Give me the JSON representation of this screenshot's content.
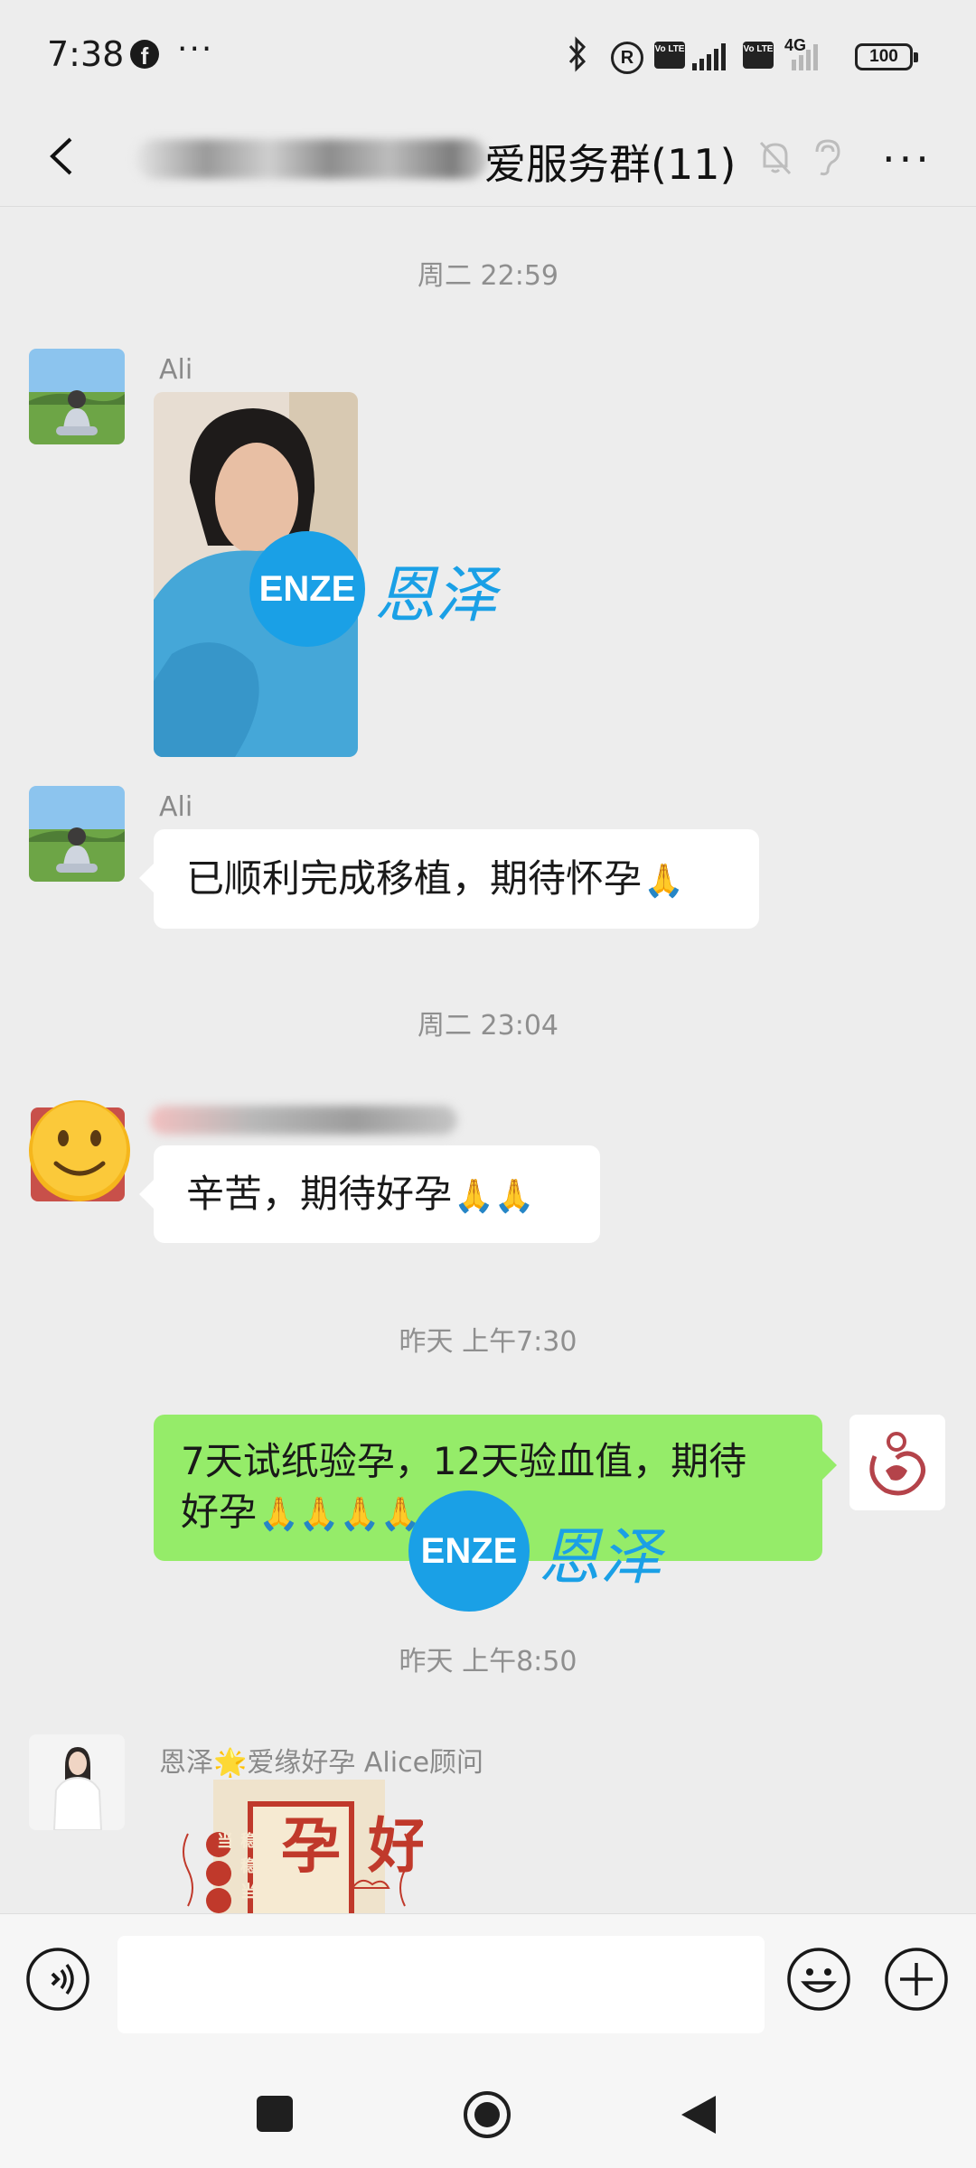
{
  "status": {
    "time": "7:38",
    "more": "···",
    "reg_mark": "R",
    "volte": "Vo LTE",
    "net_type": "4G",
    "battery": "100"
  },
  "header": {
    "title": "爱服务群(11)"
  },
  "messages": [
    {
      "type": "time",
      "text": "周二 22:59"
    },
    {
      "type": "image",
      "sender": "Ali",
      "watermark_logo": "ENZE",
      "watermark_text": "恩泽"
    },
    {
      "type": "text",
      "sender": "Ali",
      "text": "已顺利完成移植，期待怀孕",
      "emoji": "🙏"
    },
    {
      "type": "time",
      "text": "周二 23:04"
    },
    {
      "type": "text",
      "sender": "",
      "text": "辛苦，期待好孕",
      "emoji": "🙏🙏"
    },
    {
      "type": "time",
      "text": "昨天 上午7:30"
    },
    {
      "type": "outgoing",
      "line1": "7天试纸验孕，12天验血值，期待",
      "line2": "好孕",
      "emoji": "🙏🙏🙏🙏",
      "watermark_logo": "ENZE",
      "watermark_text": "恩泽"
    },
    {
      "type": "time",
      "text": "昨天 上午8:50"
    },
    {
      "type": "image",
      "sender": "恩泽🌟爱缘好孕 Alice顾问",
      "card_big": "好孕",
      "card_side": "稳稳当当"
    }
  ]
}
